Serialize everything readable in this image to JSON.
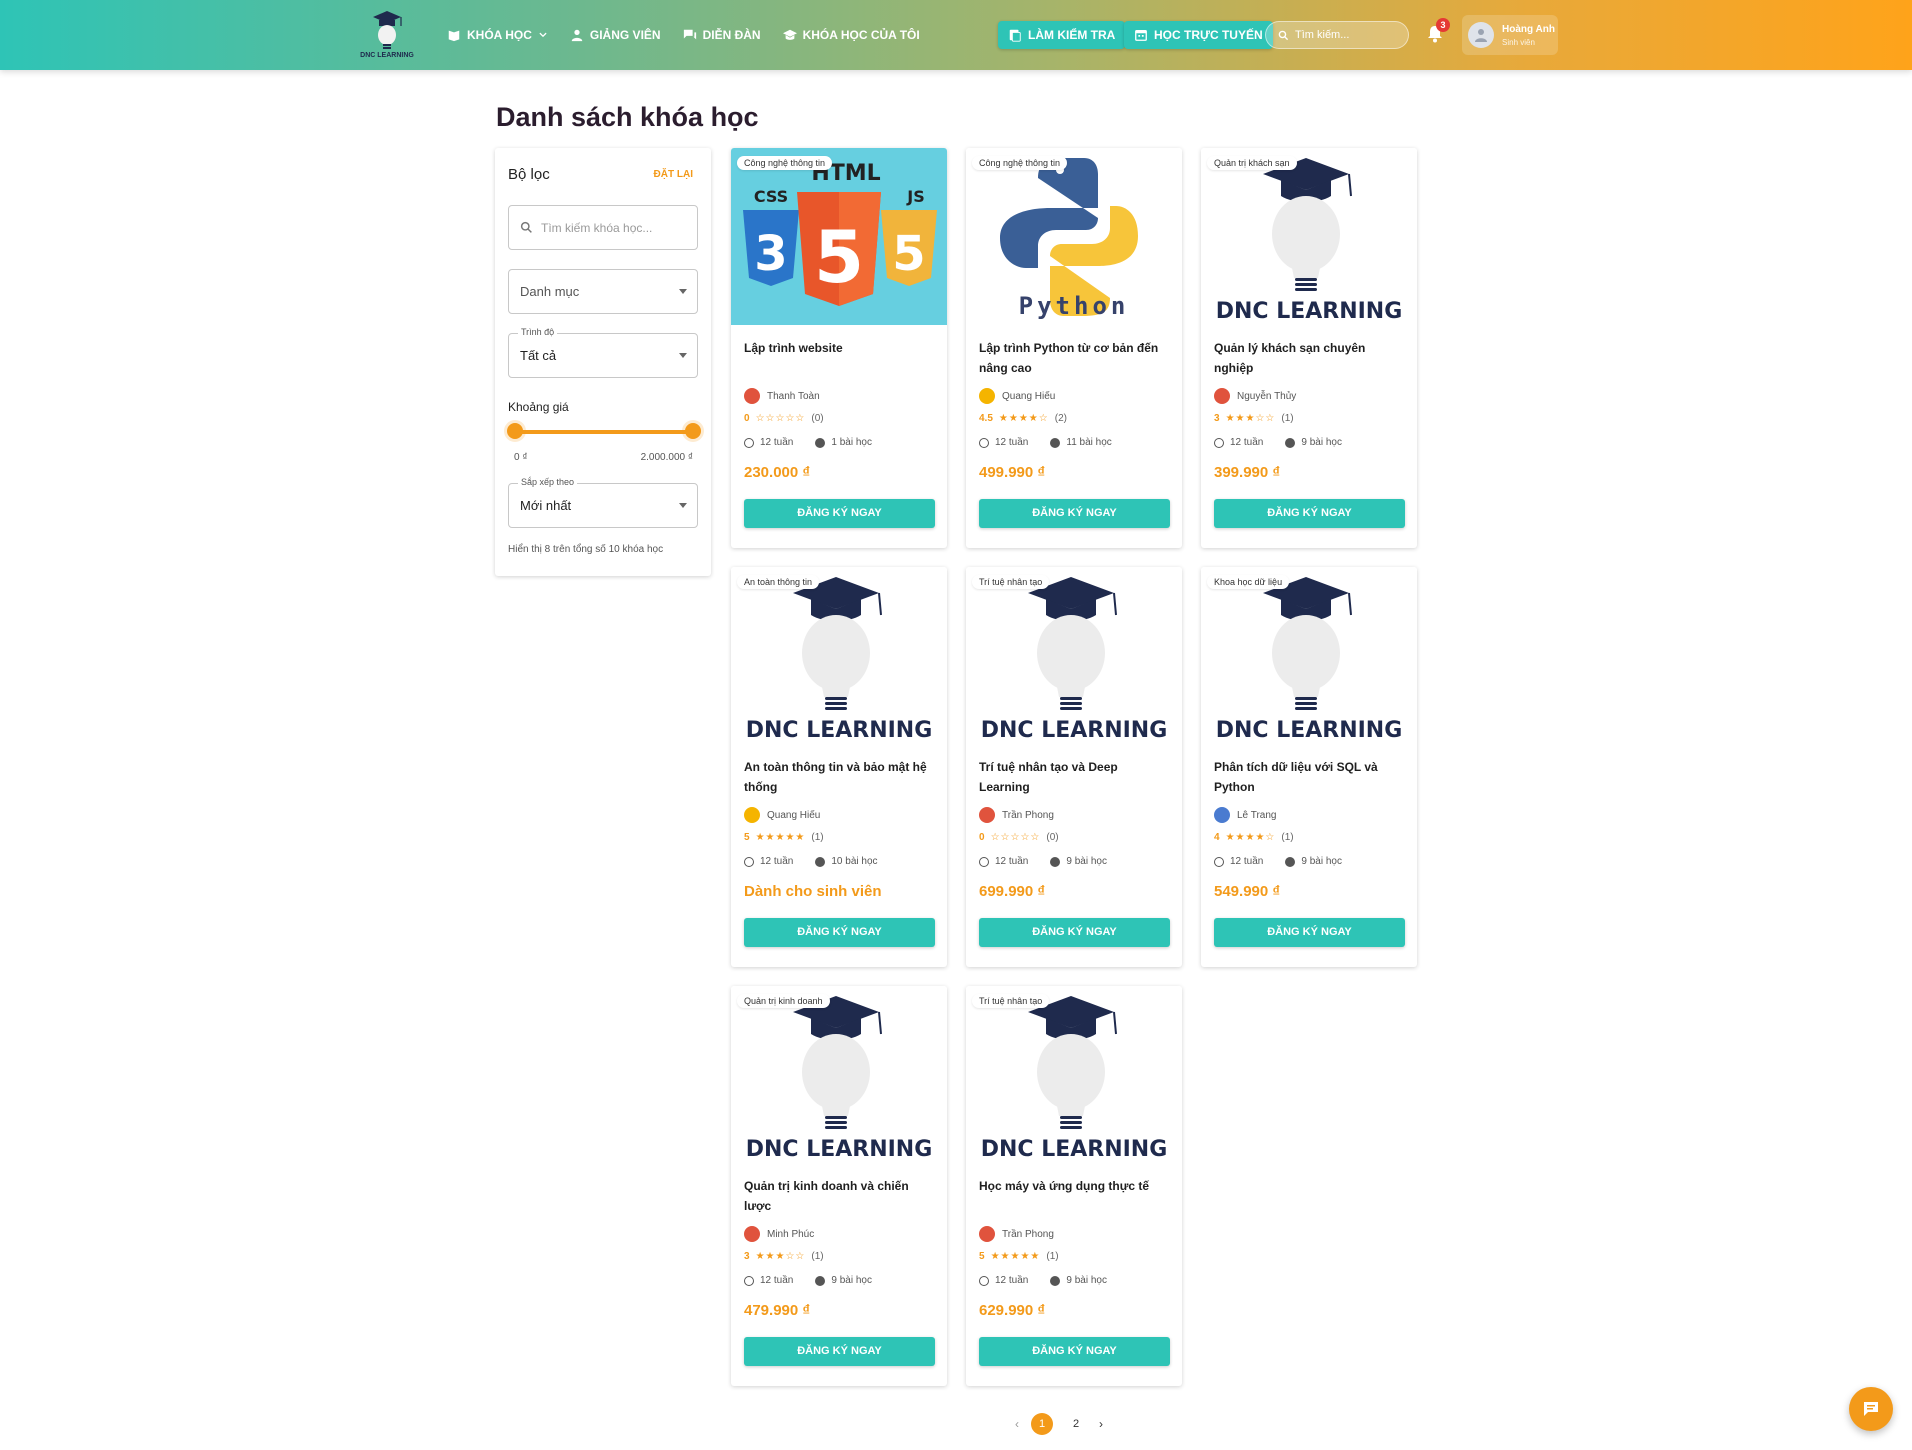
{
  "header": {
    "logo_text": "DNC LEARNING",
    "nav": [
      {
        "label": "Khóa học",
        "icon": "book-icon"
      },
      {
        "label": "Giảng viên",
        "icon": "person-icon"
      },
      {
        "label": "Diễn đàn",
        "icon": "forum-icon"
      },
      {
        "label": "Khóa học của tôi",
        "icon": "graduation-icon"
      }
    ],
    "quiz_button": "LÀM KIỂM TRA",
    "online_button": "HỌC TRỰC TUYẾN",
    "search_placeholder": "Tìm kiếm...",
    "notification_count": "3",
    "user_name": "Hoàng Anh",
    "user_role": "Sinh viên"
  },
  "page": {
    "title": "Danh sách khóa học"
  },
  "filter": {
    "title": "Bộ lọc",
    "reset": "ĐẶT LẠI",
    "search_placeholder": "Tìm kiếm khóa học...",
    "category_placeholder": "Danh mục",
    "level_label": "Trình độ",
    "level_value": "Tất cả",
    "price_label": "Khoảng giá",
    "price_min": "0 ₫",
    "price_max": "2.000.000 ₫",
    "sort_label": "Sắp xếp theo",
    "sort_value": "Mới nhất",
    "count_text": "Hiển thị 8 trên tổng số 10 khóa học"
  },
  "courses": [
    {
      "tag": "Công nghệ thông tin",
      "title": "Lập trình website",
      "author": "Thanh Toàn",
      "rating": "0",
      "stars": "☆☆☆☆☆",
      "reviews": "(0)",
      "duration": "12 tuần",
      "lessons": "1 bài học",
      "price": "230.000 ₫",
      "button": "ĐĂNG KÝ NGAY",
      "thumb": "html",
      "avatar_color": "#e0533d"
    },
    {
      "tag": "Công nghệ thông tin",
      "title": "Lập trình Python từ cơ bản đến nâng cao",
      "author": "Quang Hiếu",
      "rating": "4.5",
      "stars": "★★★★☆",
      "reviews": "(2)",
      "duration": "12 tuần",
      "lessons": "11 bài học",
      "price": "499.990 ₫",
      "button": "ĐĂNG KÝ NGAY",
      "thumb": "python",
      "avatar_color": "#f5b400"
    },
    {
      "tag": "Quản trị khách sạn",
      "title": "Quản lý khách sạn chuyên nghiệp",
      "author": "Nguyễn Thủy",
      "rating": "3",
      "stars": "★★★☆☆",
      "reviews": "(1)",
      "duration": "12 tuần",
      "lessons": "9 bài học",
      "price": "399.990 ₫",
      "button": "ĐĂNG KÝ NGAY",
      "thumb": "dnc",
      "avatar_color": "#e0533d"
    },
    {
      "tag": "An toàn thông tin",
      "title": "An toàn thông tin và bảo mật hệ thống",
      "author": "Quang Hiếu",
      "rating": "5",
      "stars": "★★★★★",
      "reviews": "(1)",
      "duration": "12 tuần",
      "lessons": "10 bài học",
      "price": "Dành cho sinh viên",
      "button": "ĐĂNG KÝ NGAY",
      "thumb": "dnc",
      "avatar_color": "#f5b400"
    },
    {
      "tag": "Trí tuệ nhân tạo",
      "title": "Trí tuệ nhân tạo và Deep Learning",
      "author": "Trần Phong",
      "rating": "0",
      "stars": "☆☆☆☆☆",
      "reviews": "(0)",
      "duration": "12 tuần",
      "lessons": "9 bài học",
      "price": "699.990 ₫",
      "button": "ĐĂNG KÝ NGAY",
      "thumb": "dnc",
      "avatar_color": "#e0533d"
    },
    {
      "tag": "Khoa học dữ liệu",
      "title": "Phân tích dữ liệu với SQL và Python",
      "author": "Lê Trang",
      "rating": "4",
      "stars": "★★★★☆",
      "reviews": "(1)",
      "duration": "12 tuần",
      "lessons": "9 bài học",
      "price": "549.990 ₫",
      "button": "ĐĂNG KÝ NGAY",
      "thumb": "dnc",
      "avatar_color": "#4a7bd0"
    },
    {
      "tag": "Quản trị kinh doanh",
      "title": "Quản trị kinh doanh và chiến lược",
      "author": "Minh Phúc",
      "rating": "3",
      "stars": "★★★☆☆",
      "reviews": "(1)",
      "duration": "12 tuần",
      "lessons": "9 bài học",
      "price": "479.990 ₫",
      "button": "ĐĂNG KÝ NGAY",
      "thumb": "dnc",
      "avatar_color": "#e0533d"
    },
    {
      "tag": "Trí tuệ nhân tạo",
      "title": "Học máy và ứng dụng thực tế",
      "author": "Trần Phong",
      "rating": "5",
      "stars": "★★★★★",
      "reviews": "(1)",
      "duration": "12 tuần",
      "lessons": "9 bài học",
      "price": "629.990 ₫",
      "button": "ĐĂNG KÝ NGAY",
      "thumb": "dnc",
      "avatar_color": "#e0533d"
    }
  ],
  "thumb_text": {
    "dnc": "DNC LEARNING",
    "python": "Python",
    "html_top": "HTML",
    "html_css": "CSS",
    "html_js": "JS"
  },
  "pagination": {
    "prev": "‹",
    "pages": [
      "1",
      "2"
    ],
    "active": "1",
    "next": "›"
  },
  "colors": {
    "accent": "#f39a1a",
    "teal": "#2ec4b6",
    "navy": "#1f2a4d"
  }
}
